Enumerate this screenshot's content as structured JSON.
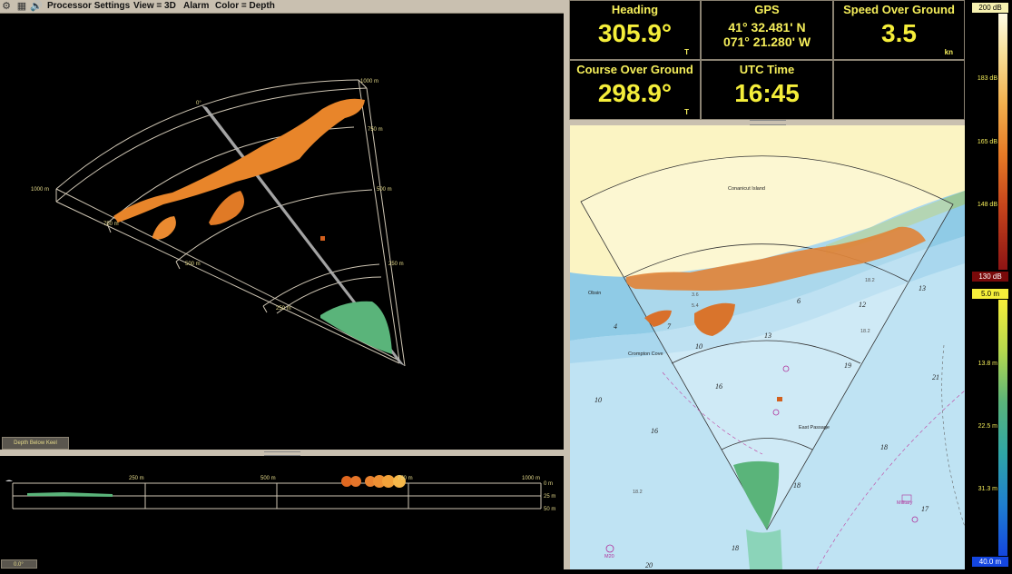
{
  "toolbar": {
    "icons": [
      "gear-icon",
      "grid-icon",
      "speaker-icon"
    ],
    "menu": [
      "Processor Settings",
      "View = 3D",
      "Alarm",
      "Color = Depth"
    ]
  },
  "view3d": {
    "range_labels_left": [
      "1000 m",
      "750 m",
      "500 m",
      "250 m"
    ],
    "range_labels_right": [
      "1000 m",
      "750 m",
      "500 m",
      "250 m"
    ],
    "bearing_label": "0°",
    "depth_button": "Depth Below Keel"
  },
  "profile": {
    "range_labels": [
      "250 m",
      "500 m",
      "750 m",
      "1000 m"
    ],
    "depth_labels": [
      "0 m",
      "25 m",
      "50 m"
    ],
    "heading_readout": "0.0°"
  },
  "instruments": {
    "heading": {
      "label": "Heading",
      "value": "305.9°",
      "unit": "T"
    },
    "gps": {
      "label": "GPS",
      "lat": "41° 32.481' N",
      "lon": "071° 21.280' W"
    },
    "sog": {
      "label": "Speed Over Ground",
      "value": "3.5",
      "unit": "kn"
    },
    "cog": {
      "label": "Course Over Ground",
      "value": "298.9°",
      "unit": "T"
    },
    "utc": {
      "label": "UTC Time",
      "value": "16:45"
    }
  },
  "chart": {
    "place_labels": [
      "Conanicut Island",
      "Crompton Cove",
      "East Passage",
      "Obsin"
    ],
    "soundings": [
      "13",
      "12",
      "10",
      "13",
      "19",
      "16",
      "10",
      "16",
      "18",
      "18",
      "21",
      "17",
      "18",
      "20",
      "7",
      "6",
      "4",
      "18.2",
      "18.2",
      "3.6",
      "5.4",
      "18.2"
    ],
    "markers": [
      "M20",
      "Military"
    ]
  },
  "scales": {
    "db": {
      "top": "200 dB",
      "ticks": [
        "183 dB",
        "165 dB",
        "148 dB"
      ],
      "bottom": "130 dB"
    },
    "depth": {
      "top": "5.0 m",
      "ticks": [
        "13.8 m",
        "22.5 m",
        "31.3 m"
      ],
      "bottom": "40.0 m"
    }
  },
  "colors": {
    "accent": "#f5ee3a",
    "toolbar": "#c9c0b0",
    "target_orange": "#e8852a",
    "bottom_green": "#5ab47a"
  }
}
